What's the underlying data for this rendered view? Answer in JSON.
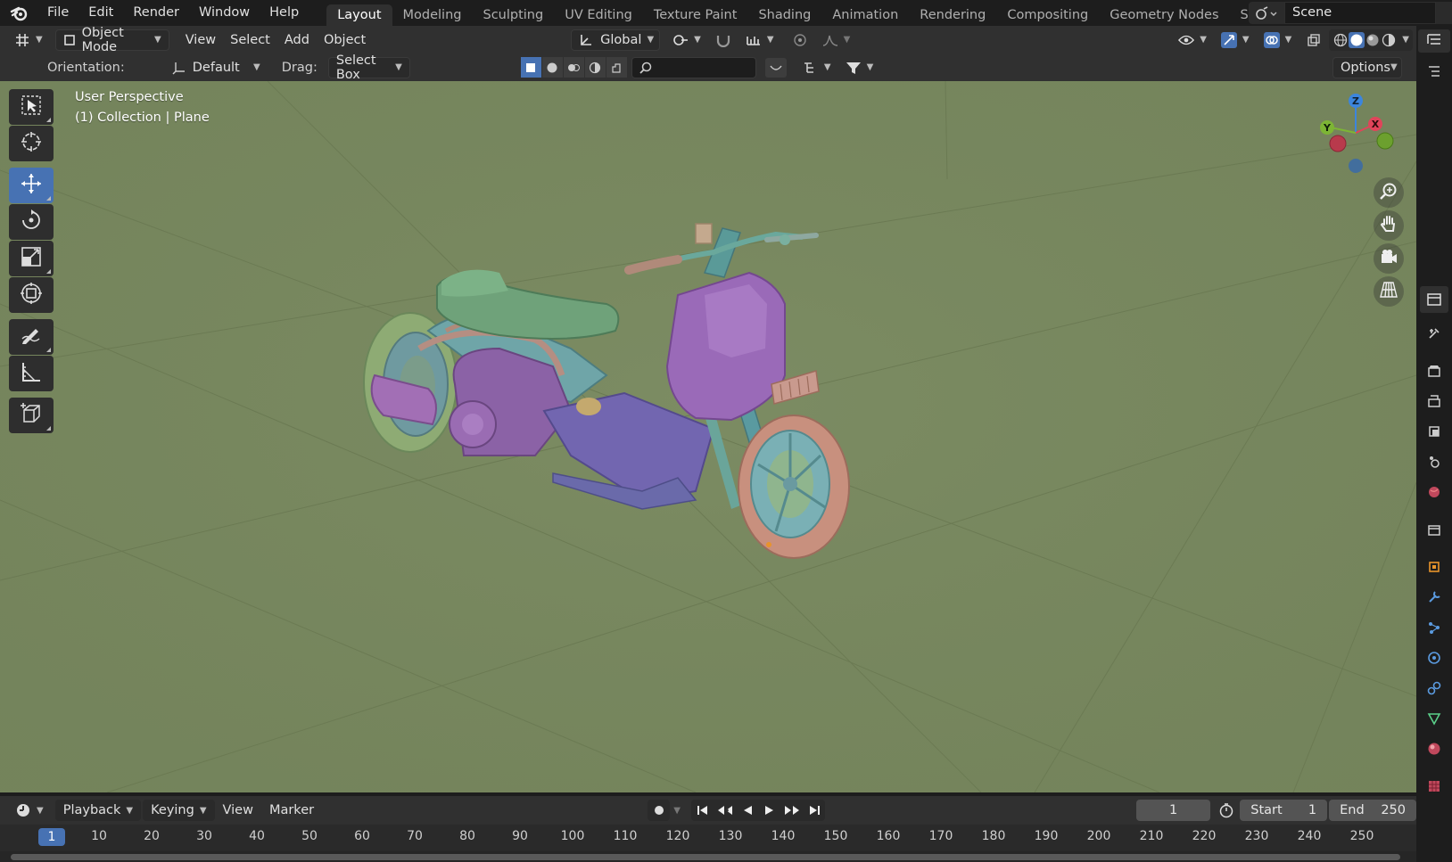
{
  "menu": {
    "items": [
      "File",
      "Edit",
      "Render",
      "Window",
      "Help"
    ]
  },
  "workspaces": {
    "tabs": [
      "Layout",
      "Modeling",
      "Sculpting",
      "UV Editing",
      "Texture Paint",
      "Shading",
      "Animation",
      "Rendering",
      "Compositing",
      "Geometry Nodes",
      "Scripting"
    ],
    "active": "Layout"
  },
  "scene": {
    "name": "Scene"
  },
  "header": {
    "mode": "Object Mode",
    "menus": [
      "View",
      "Select",
      "Add",
      "Object"
    ],
    "transform_orientation": "Global",
    "options_label": "Options"
  },
  "tool_settings": {
    "orientation_label": "Orientation:",
    "orientation_value": "Default",
    "drag_label": "Drag:",
    "drag_value": "Select Box"
  },
  "viewport": {
    "view_name": "User Perspective",
    "collection_info": "(1) Collection | Plane",
    "background_color": "#77875e"
  },
  "gizmo": {
    "x_label": "X",
    "y_label": "Y",
    "z_label": "Z",
    "colors": {
      "x": "#e0445a",
      "y": "#7db535",
      "z": "#3c85dd"
    }
  },
  "timeline": {
    "menus": [
      "Playback",
      "Keying",
      "View",
      "Marker"
    ],
    "current_frame": "1",
    "start_label": "Start",
    "start_value": "1",
    "end_label": "End",
    "end_value": "250",
    "ruler_current": "1",
    "ruler_ticks": [
      "10",
      "20",
      "30",
      "40",
      "50",
      "60",
      "70",
      "80",
      "90",
      "100",
      "110",
      "120",
      "130",
      "140",
      "150",
      "160",
      "170",
      "180",
      "190",
      "200",
      "210",
      "220",
      "230",
      "240",
      "250"
    ]
  },
  "colors": {
    "accent": "#4772b3",
    "panel": "#303030",
    "bg": "#1d1d1d"
  }
}
